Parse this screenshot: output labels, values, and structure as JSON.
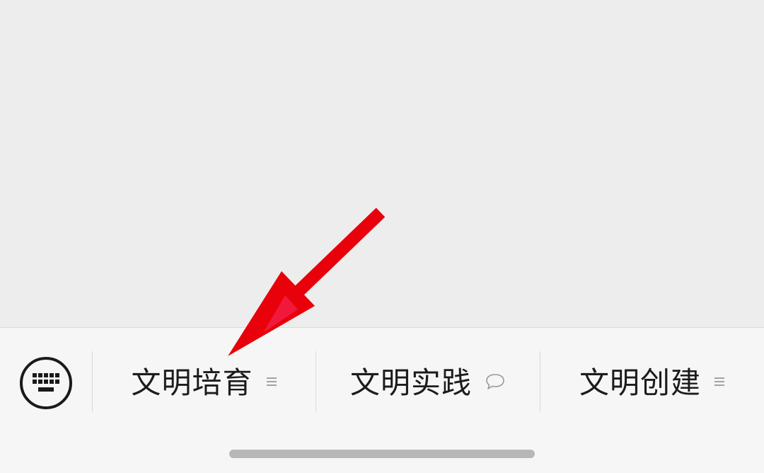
{
  "bottom_menu": {
    "keyboard_icon": "keyboard-icon",
    "tabs": [
      {
        "label": "文明培育",
        "icon": "menu-lines-icon"
      },
      {
        "label": "文明实践",
        "icon": "chat-bubble-icon"
      },
      {
        "label": "文明创建",
        "icon": "menu-lines-icon"
      }
    ]
  },
  "annotation": {
    "type": "red-arrow",
    "color": "#e8000b"
  }
}
